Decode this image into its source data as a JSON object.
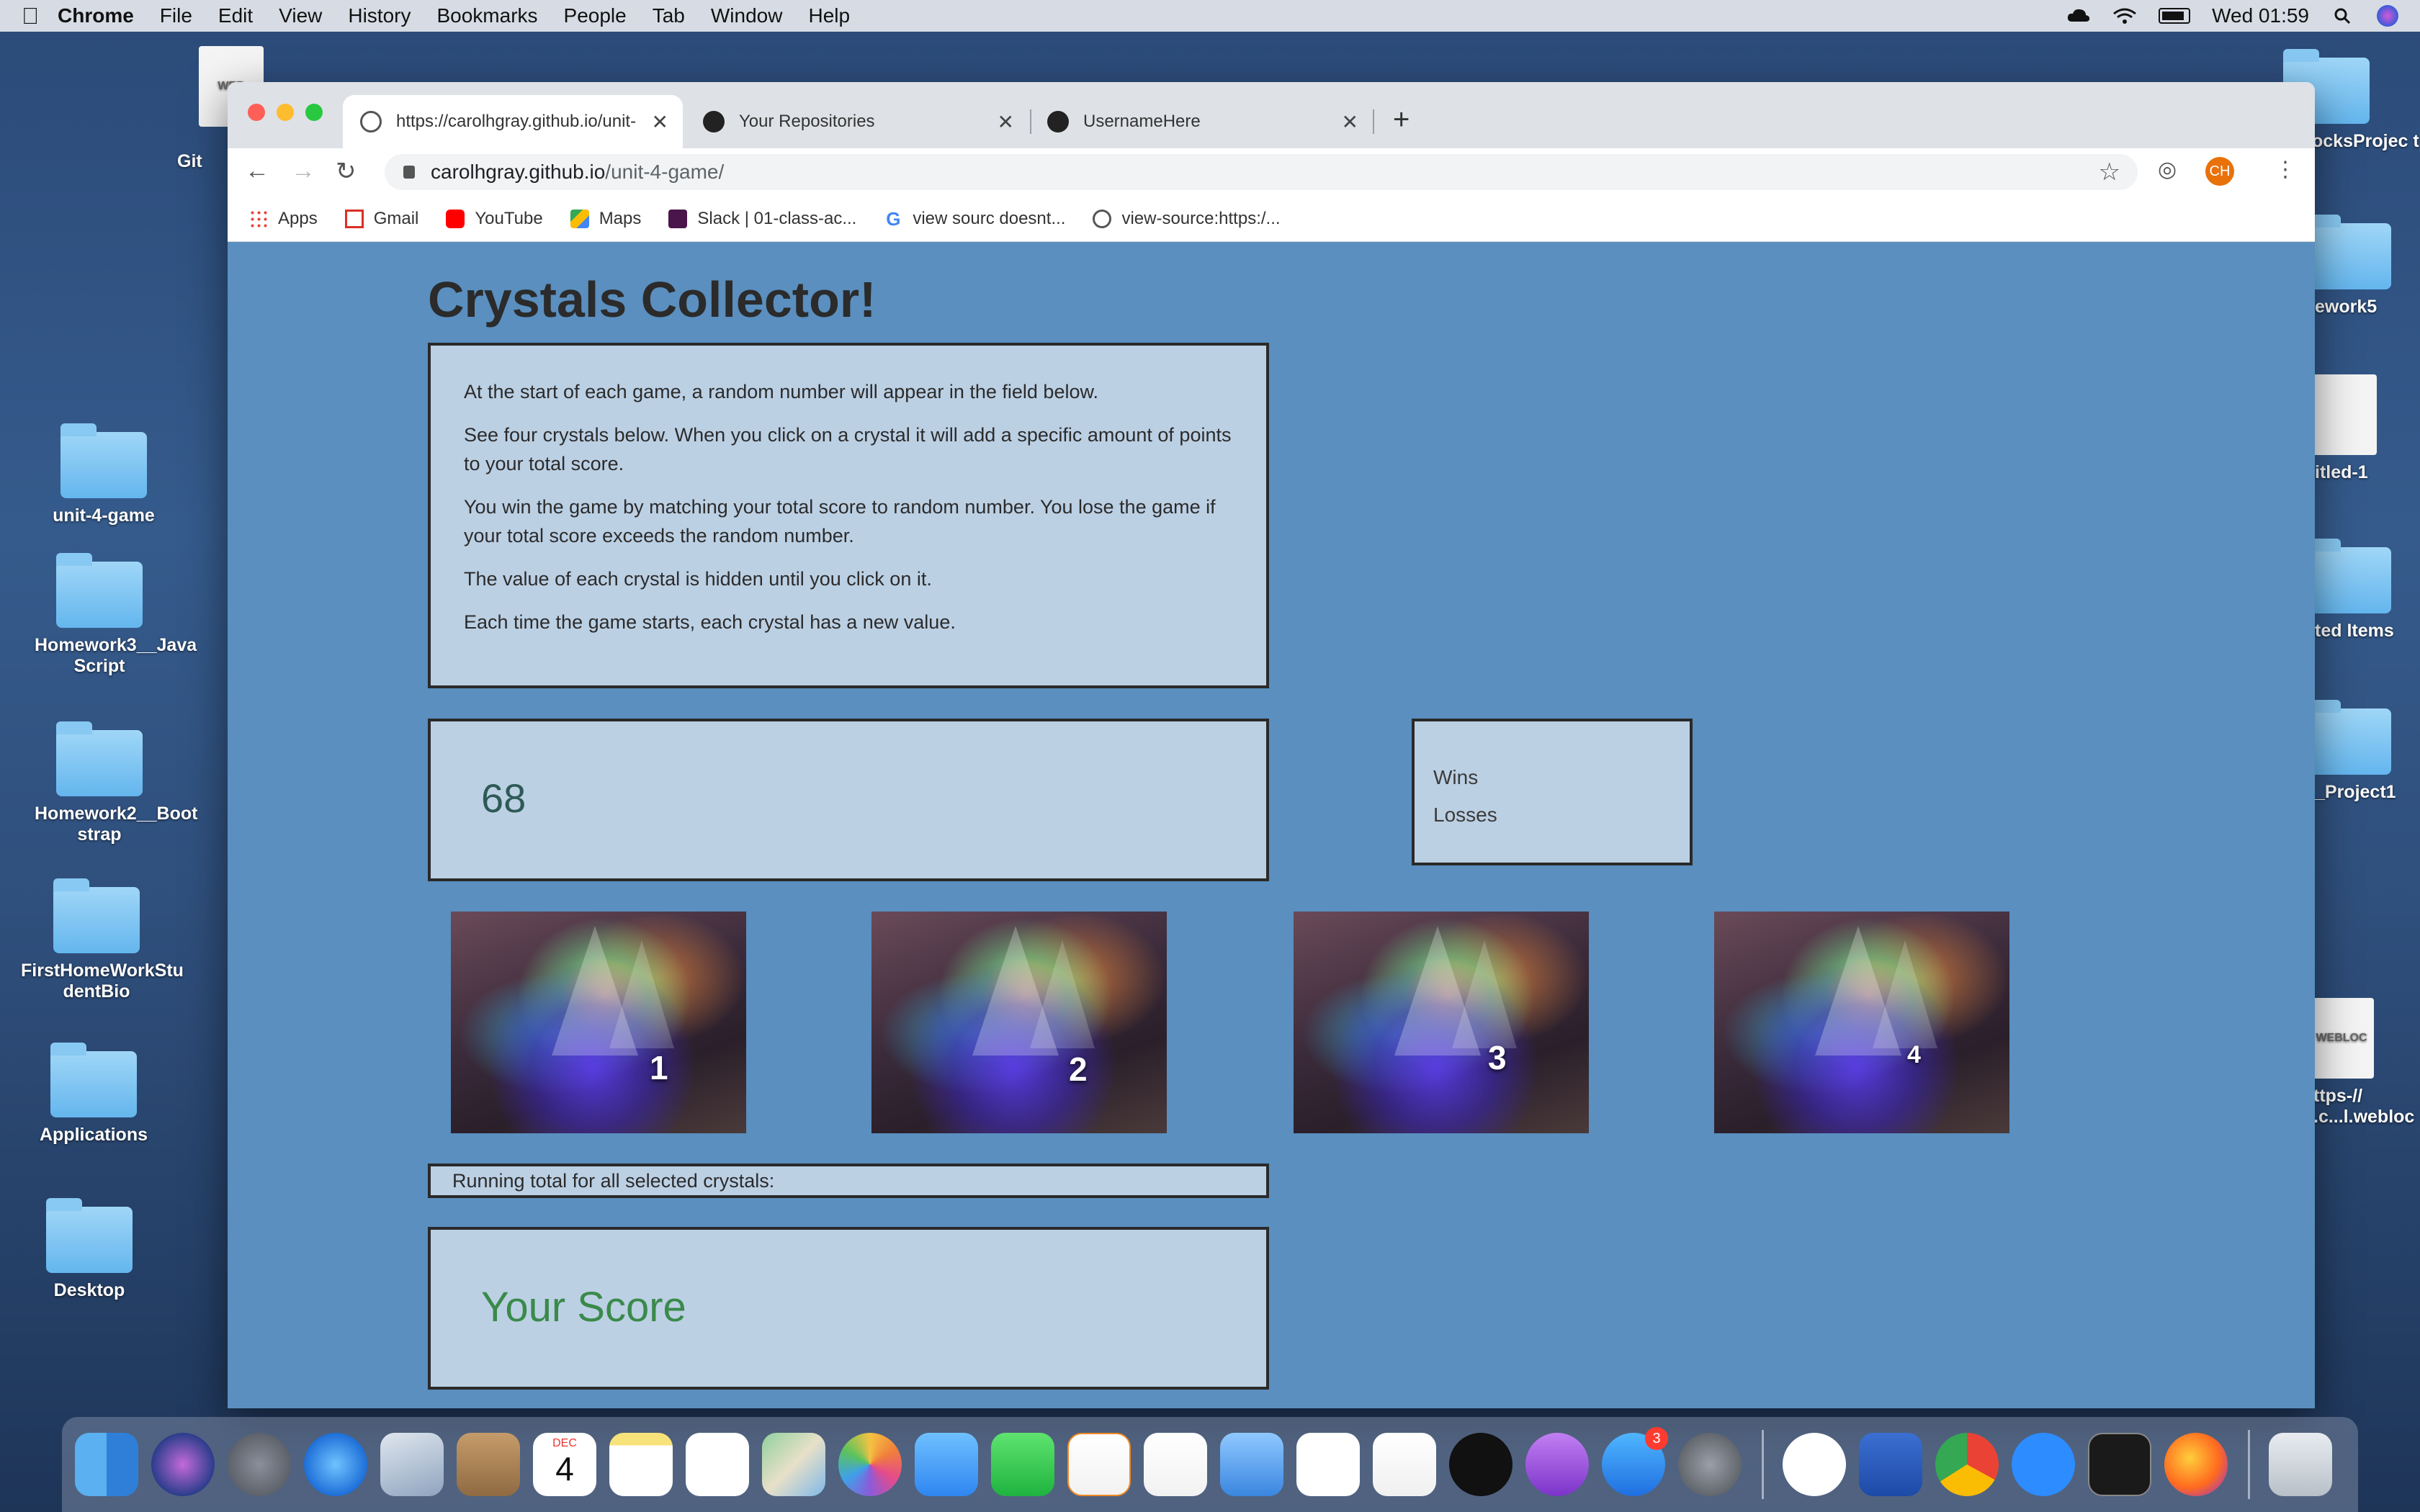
{
  "menubar": {
    "app_name": "Chrome",
    "items": [
      "File",
      "Edit",
      "View",
      "History",
      "Bookmarks",
      "People",
      "Tab",
      "Window",
      "Help"
    ],
    "clock": "Wed 01:59"
  },
  "desktop": {
    "left_icons": [
      "unit-4-game",
      "Homework3__Java Script",
      "Homework2__Boot strap",
      "FirstHomeWorkStu dentBio",
      "Applications",
      "Desktop"
    ],
    "right_icons": [
      "ocksProjec t",
      "ework5",
      "itled-1",
      "ted Items",
      "_Project1",
      "ttps-// .c...l.webloc"
    ],
    "top_partial_label": "Git"
  },
  "browser": {
    "tabs": [
      {
        "title": "https://carolhgray.github.io/unit-",
        "icon": "globe-icon",
        "active": true
      },
      {
        "title": "Your Repositories",
        "icon": "github-icon",
        "active": false
      },
      {
        "title": "UsernameHere",
        "icon": "github-icon",
        "active": false
      }
    ],
    "url_host": "carolhgray.github.io",
    "url_path": "/unit-4-game/",
    "profile_initials": "CH",
    "bookmarks": [
      {
        "label": "Apps",
        "icon": "apps-grid-icon"
      },
      {
        "label": "Gmail",
        "icon": "gmail-icon"
      },
      {
        "label": "YouTube",
        "icon": "youtube-icon"
      },
      {
        "label": "Maps",
        "icon": "maps-icon"
      },
      {
        "label": "Slack | 01-class-ac...",
        "icon": "slack-icon"
      },
      {
        "label": "view sourc doesnt...",
        "icon": "google-icon"
      },
      {
        "label": "view-source:https:/...",
        "icon": "globe-icon"
      }
    ]
  },
  "game": {
    "title": "Crystals Collector!",
    "instructions": [
      "At the start of each game, a random number will appear in the field below.",
      "See four crystals below. When you click on a crystal it will add a specific amount of points to your total score.",
      "You win the game by matching your total score to random number. You lose the game if your total score exceeds the random number.",
      "The value of each crystal is hidden until you click on it.",
      "Each time the game starts, each crystal has a new value."
    ],
    "target_number": "68",
    "wins_label": "Wins",
    "losses_label": "Losses",
    "crystals": [
      "1",
      "2",
      "3",
      "4"
    ],
    "running_total_label": "Running total for all selected crystals:",
    "your_score_label": "Your Score"
  },
  "dock": {
    "apps": [
      "finder",
      "siri",
      "launchpad",
      "safari",
      "mail-eagle",
      "contacts",
      "calendar",
      "notes",
      "reminders",
      "maps",
      "photos",
      "messages",
      "facetime",
      "pages",
      "numbers",
      "keynote",
      "news",
      "music",
      "apple-tv",
      "podcasts",
      "app-store",
      "system-preferences"
    ],
    "calendar_month": "DEC",
    "calendar_day": "4",
    "app_store_badge": "3",
    "apps_right": [
      "slack",
      "word",
      "chrome",
      "zoom",
      "terminal",
      "firefox"
    ]
  },
  "colors": {
    "page_bg": "#5a8fbf",
    "panel_bg": "#bcd0e4",
    "score_green": "#3a8a4a",
    "target_teal": "#2d5a56"
  }
}
